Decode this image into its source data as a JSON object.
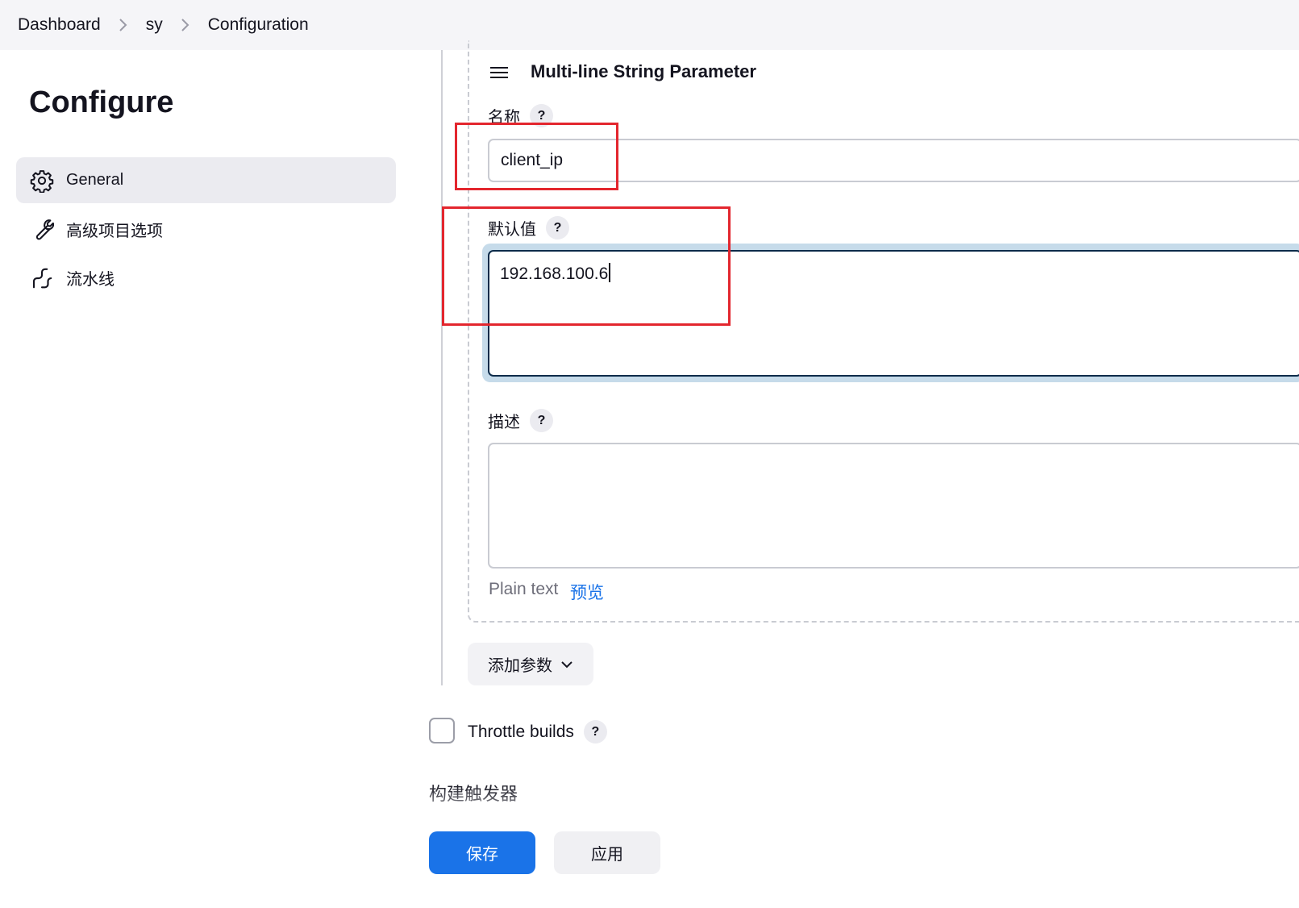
{
  "breadcrumb": {
    "items": [
      "Dashboard",
      "sy",
      "Configuration"
    ]
  },
  "sidebar": {
    "title": "Configure",
    "items": [
      {
        "label": "General",
        "icon": "gear-icon",
        "active": true
      },
      {
        "label": "高级项目选项",
        "icon": "wrench-icon",
        "active": false
      },
      {
        "label": "流水线",
        "icon": "pipeline-icon",
        "active": false
      }
    ]
  },
  "parameter": {
    "title": "Multi-line String Parameter",
    "name_label": "名称",
    "name_value": "client_ip",
    "default_label": "默认值",
    "default_value": "192.168.100.6",
    "description_label": "描述",
    "description_value": "",
    "format_label": "Plain text",
    "preview_link": "预览",
    "help_symbol": "?"
  },
  "add_parameter_button": "添加参数",
  "throttle": {
    "label": "Throttle builds",
    "checked": false
  },
  "section_heading": "构建触发器",
  "actions": {
    "save_label": "保存",
    "apply_label": "应用"
  },
  "colors": {
    "primary": "#1a73e8",
    "annotation": "#e3262e",
    "focus_border": "#0c2b4a"
  }
}
